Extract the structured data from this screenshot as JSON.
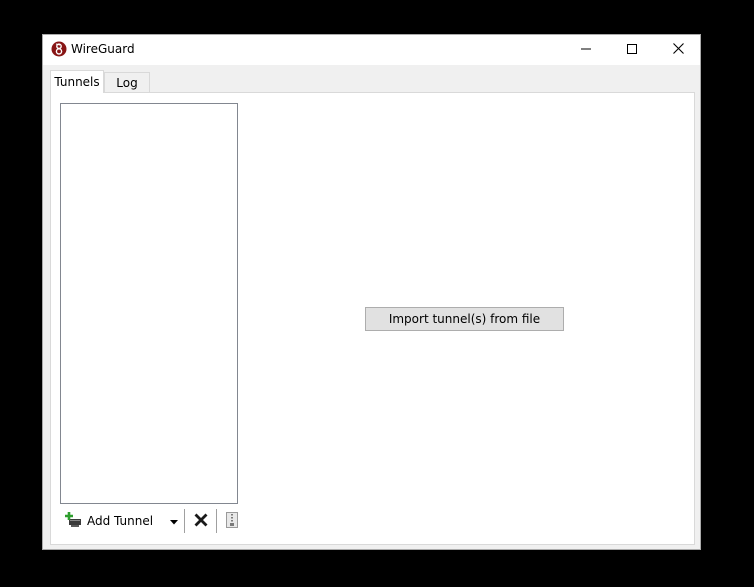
{
  "window": {
    "title": "WireGuard",
    "icon": "wireguard-logo-icon"
  },
  "caption_buttons": {
    "minimize_icon": "minimize-icon",
    "maximize_icon": "maximize-icon",
    "close_icon": "close-icon"
  },
  "tabs": [
    {
      "label": "Tunnels",
      "selected": true
    },
    {
      "label": "Log",
      "selected": false
    }
  ],
  "tunnels": {
    "items": []
  },
  "main": {
    "import_label": "Import tunnel(s) from file"
  },
  "toolbar": {
    "add_tunnel_label": "Add Tunnel",
    "add_tunnel_icon": "add-tunnel-icon",
    "dropdown_icon": "chevron-down-icon",
    "delete_icon": "delete-icon",
    "export_icon": "export-zip-icon"
  },
  "colors": {
    "accent": "#881515",
    "add_icon_green": "#2e9e2e"
  }
}
